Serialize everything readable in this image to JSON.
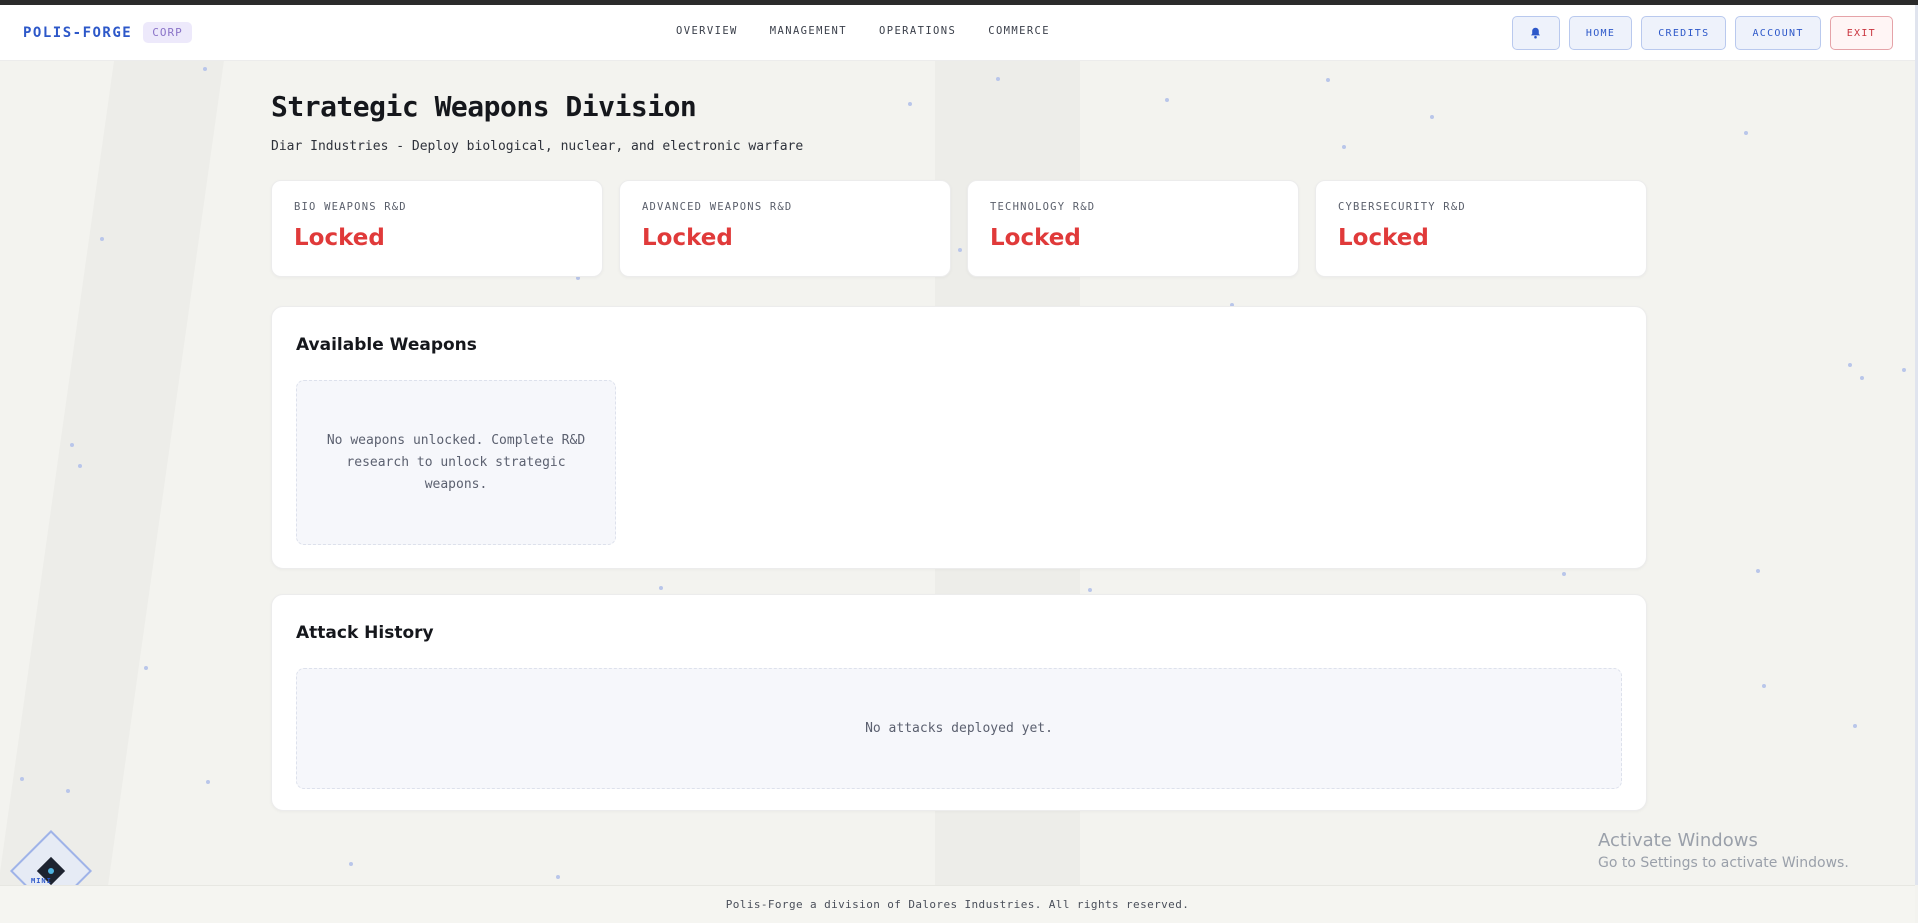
{
  "header": {
    "brand": "POLIS-FORGE",
    "badge": "CORP",
    "nav": [
      "OVERVIEW",
      "MANAGEMENT",
      "OPERATIONS",
      "COMMERCE"
    ],
    "actions": {
      "bell_icon": "bell-icon",
      "home": "HOME",
      "credits": "CREDITS",
      "account": "ACCOUNT",
      "exit": "EXIT"
    }
  },
  "page": {
    "title": "Strategic Weapons Division",
    "subtitle": "Diar Industries - Deploy biological, nuclear, and electronic warfare"
  },
  "stats": [
    {
      "label": "BIO WEAPONS R&D",
      "value": "Locked"
    },
    {
      "label": "ADVANCED WEAPONS R&D",
      "value": "Locked"
    },
    {
      "label": "TECHNOLOGY R&D",
      "value": "Locked"
    },
    {
      "label": "CYBERSECURITY R&D",
      "value": "Locked"
    }
  ],
  "weapons": {
    "title": "Available Weapons",
    "empty": "No weapons unlocked. Complete R&D research to unlock strategic weapons."
  },
  "history": {
    "title": "Attack History",
    "empty": "No attacks deployed yet."
  },
  "mini": {
    "label": "MINI"
  },
  "watermark": {
    "title": "Activate Windows",
    "subtitle": "Go to Settings to activate Windows."
  },
  "footer": {
    "text": "Polis-Forge a division of Dalores Industries. All rights reserved."
  },
  "colors": {
    "accent": "#2d58c9",
    "locked": "#e03a3a",
    "exit": "#c9333d"
  }
}
